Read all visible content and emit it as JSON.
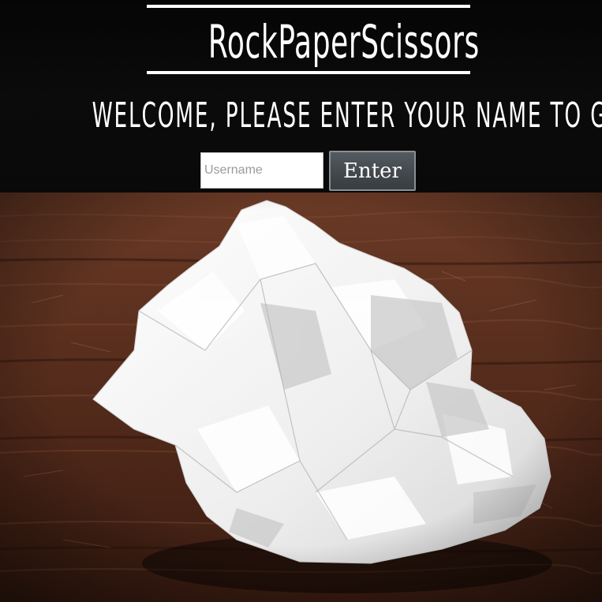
{
  "app": {
    "title": "RockPaperScissors"
  },
  "welcome": {
    "message": "WELCOME, PLEASE ENTER YOUR NAME TO GET STARTED"
  },
  "form": {
    "username_placeholder": "Username",
    "username_value": "",
    "enter_label": "Enter"
  },
  "background": {
    "image": "crumpled-paper-on-wooden-table"
  },
  "colors": {
    "header_bg": "#000000",
    "text": "#ffffff",
    "button_bg": "#454b4f",
    "button_border": "#8a8f93",
    "wood_dark": "#3a1d12",
    "wood_mid": "#6b3a25",
    "paper": "#f4f4f4"
  }
}
